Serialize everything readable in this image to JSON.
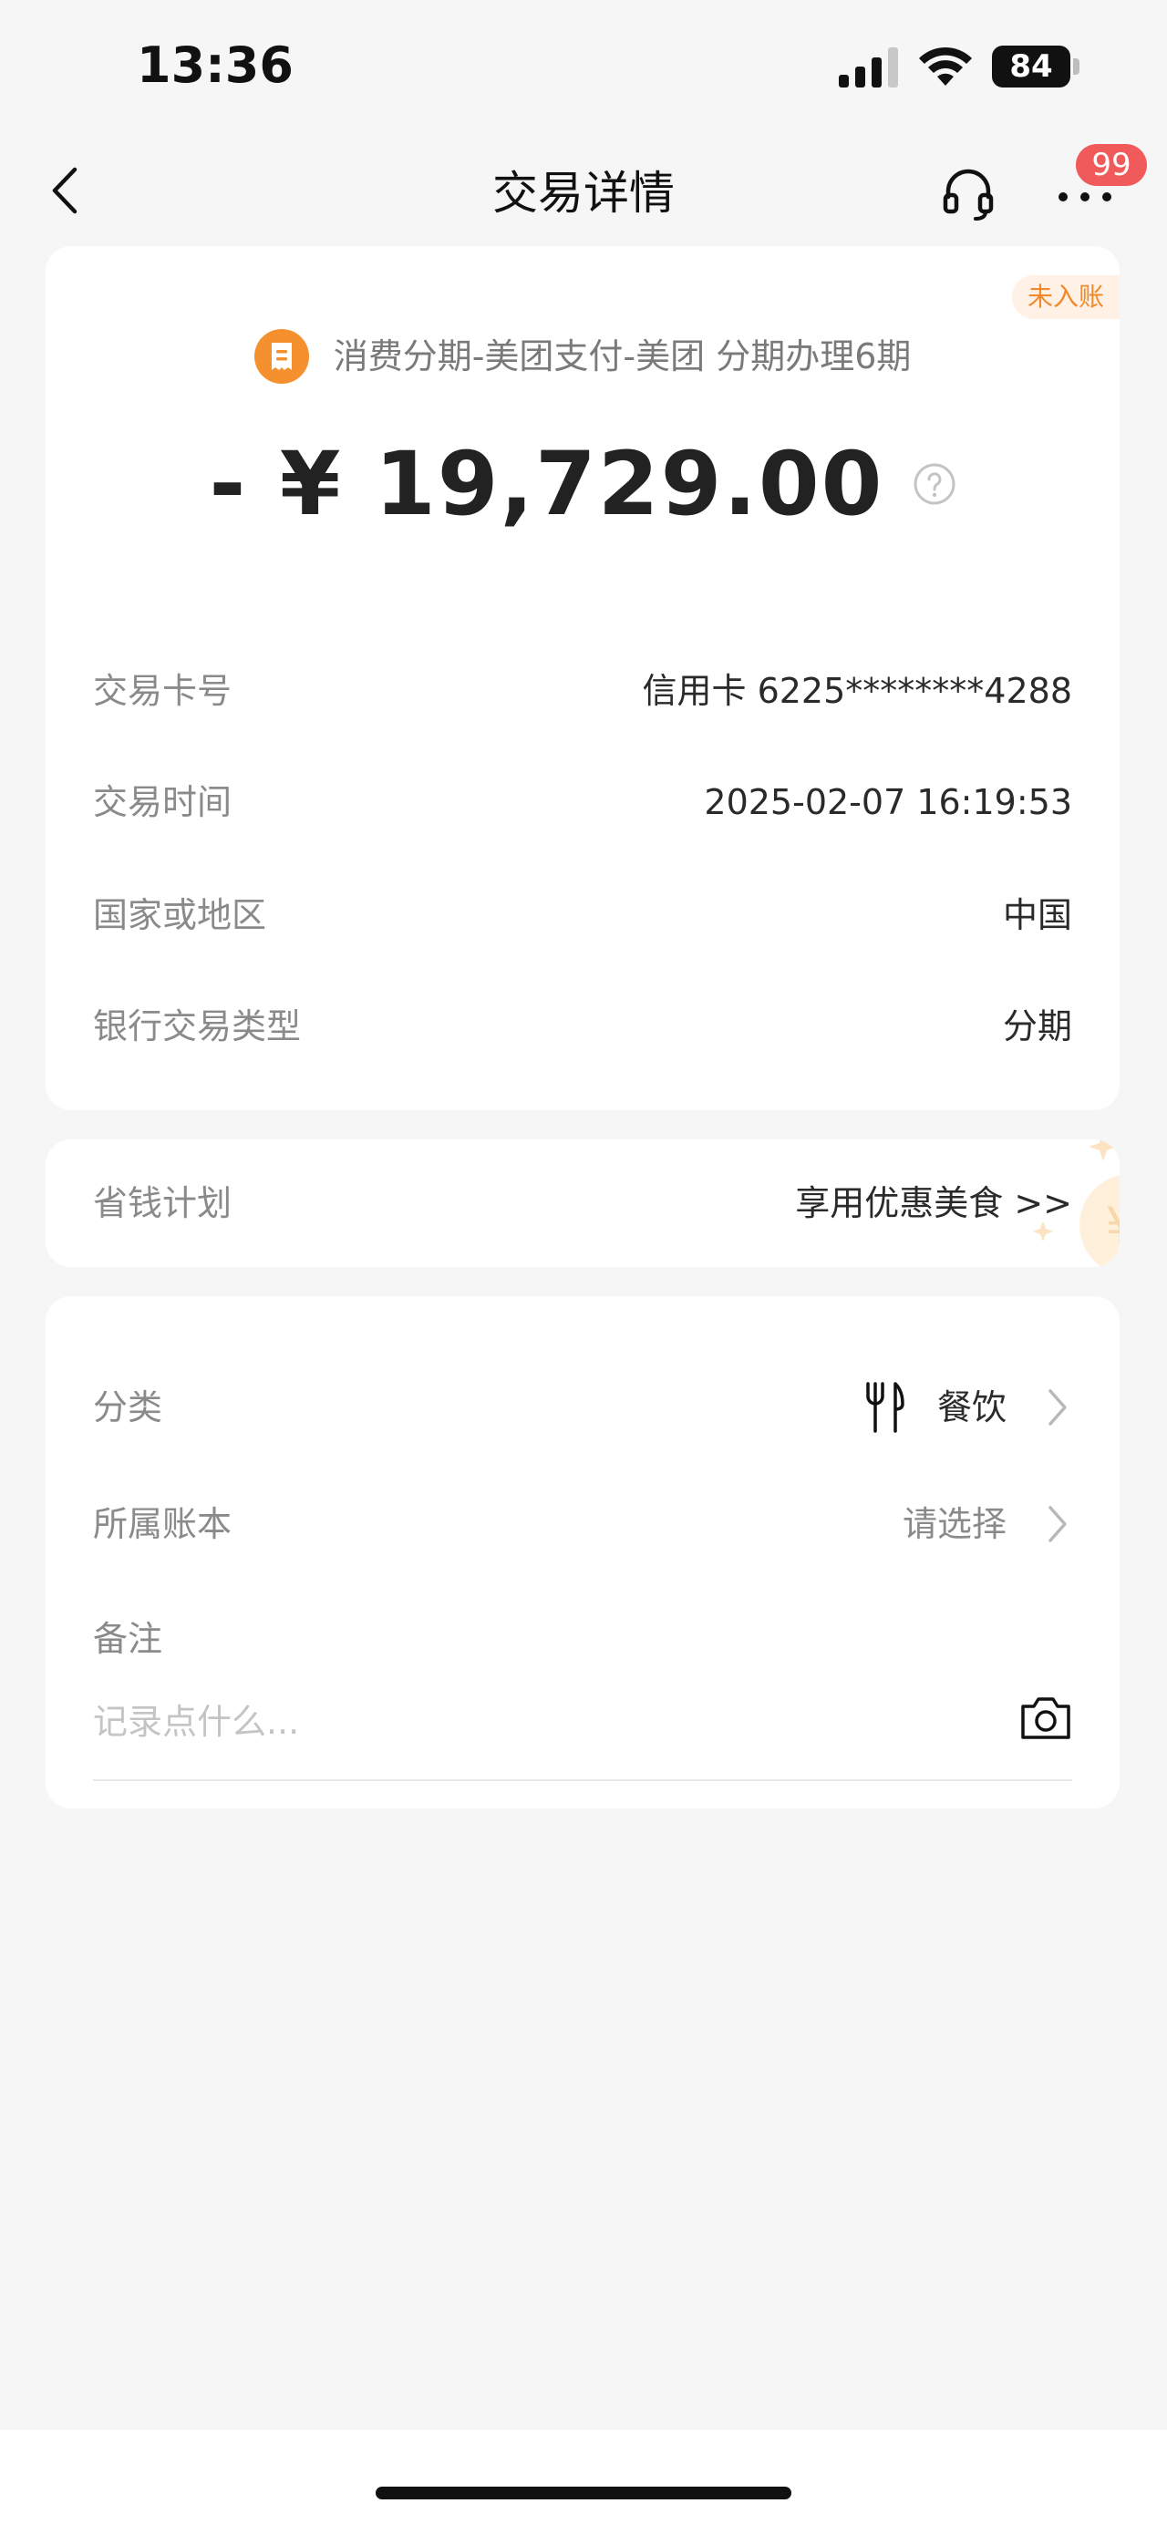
{
  "status_bar": {
    "time": "13:36",
    "battery": "84"
  },
  "nav": {
    "title": "交易详情",
    "badge_count": "99"
  },
  "transaction": {
    "status_badge": "未入账",
    "merchant": "消费分期-美团支付-美团 分期办理6期",
    "amount": "- ¥ 19,729.00",
    "details": [
      {
        "label": "交易卡号",
        "value": "信用卡 6225********4288"
      },
      {
        "label": "交易时间",
        "value": "2025-02-07 16:19:53"
      },
      {
        "label": "国家或地区",
        "value": "中国"
      },
      {
        "label": "银行交易类型",
        "value": "分期"
      }
    ]
  },
  "savings_plan": {
    "label": "省钱计划",
    "value": "享用优惠美食 >>"
  },
  "category_section": {
    "category_label": "分类",
    "category_value": "餐饮",
    "ledger_label": "所属账本",
    "ledger_value": "请选择",
    "note_label": "备注",
    "note_placeholder": "记录点什么..."
  },
  "icons": {
    "back": "chevron-left-icon",
    "service": "headset-icon",
    "more": "more-dots-icon",
    "merchant": "receipt-icon",
    "help": "question-circle-icon",
    "category": "utensils-icon",
    "arrow": "chevron-right-icon",
    "photo": "camera-icon"
  },
  "colors": {
    "accent_orange": "#f5902f",
    "badge_red": "#f05a5a",
    "background": "#f6f6f6"
  }
}
